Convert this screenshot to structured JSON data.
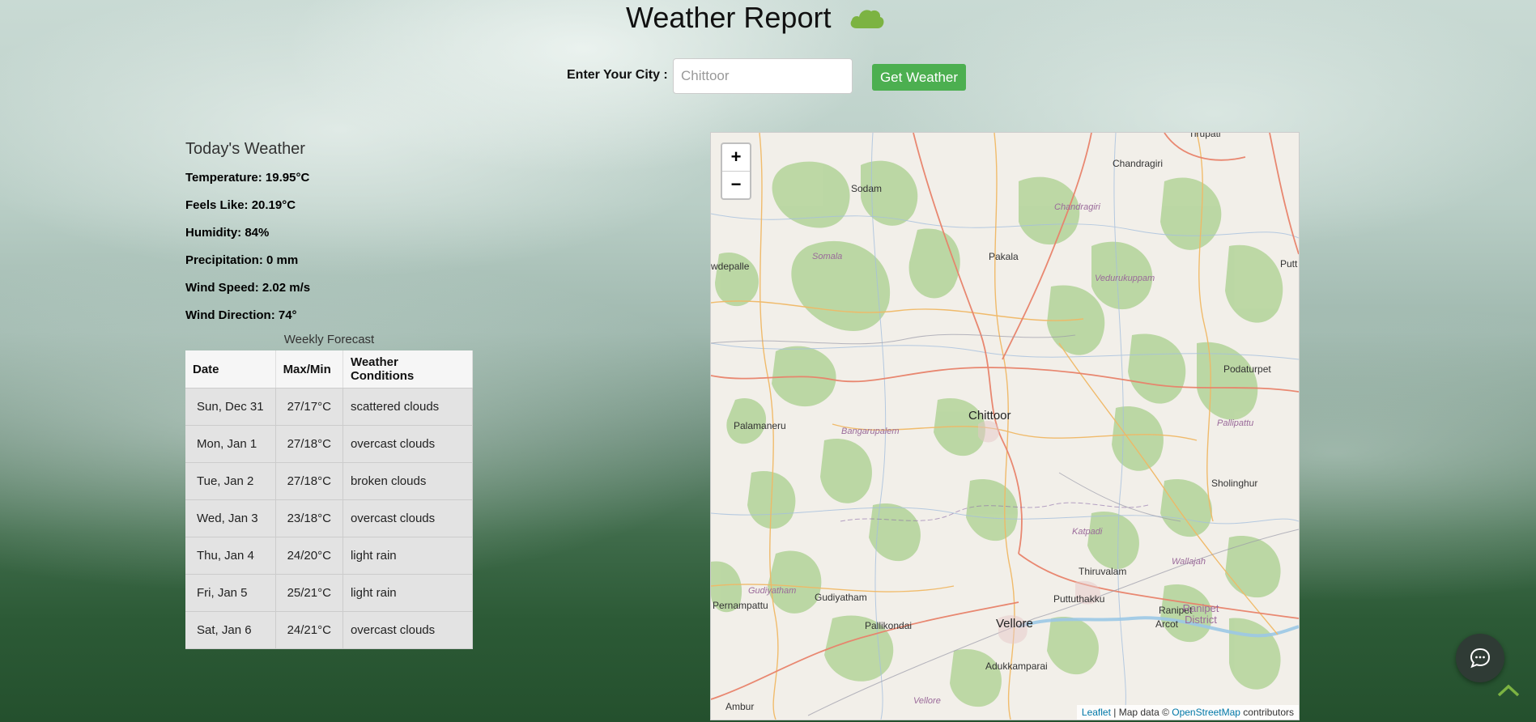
{
  "header": {
    "title": "Weather Report",
    "icon": "cloud-icon"
  },
  "search": {
    "label": "Enter Your City :",
    "placeholder": "Chittoor",
    "button_label": "Get Weather"
  },
  "today": {
    "title": "Today's Weather",
    "stats": [
      "Temperature: 19.95°C",
      "Feels Like: 20.19°C",
      "Humidity: 84%",
      "Precipitation: 0 mm",
      "Wind Speed: 2.02 m/s",
      "Wind Direction: 74°"
    ]
  },
  "forecast": {
    "caption": "Weekly Forecast",
    "headers": [
      "Date",
      "Max/Min",
      "Weather Conditions"
    ],
    "rows": [
      [
        "Sun, Dec 31",
        "27/17°C",
        "scattered clouds"
      ],
      [
        "Mon, Jan 1",
        "27/18°C",
        "overcast clouds"
      ],
      [
        "Tue, Jan 2",
        "27/18°C",
        "broken clouds"
      ],
      [
        "Wed, Jan 3",
        "23/18°C",
        "overcast clouds"
      ],
      [
        "Thu, Jan 4",
        "24/20°C",
        "light rain"
      ],
      [
        "Fri, Jan 5",
        "25/21°C",
        "light rain"
      ],
      [
        "Sat, Jan 6",
        "24/21°C",
        "overcast clouds"
      ]
    ]
  },
  "map": {
    "zoom_in": "+",
    "zoom_out": "−",
    "attribution": {
      "leaflet": "Leaflet",
      "middle": " | Map data © ",
      "osm": "OpenStreetMap",
      "end": " contributors"
    },
    "places": {
      "tirupati": "Tirupati",
      "chandragiri": "Chandragiri",
      "chandragiri_river": "Chandragiri",
      "sodam": "Sodam",
      "wdepalle": "wdepalle",
      "somala": "Somala",
      "pakala": "Pakala",
      "vedurukuppam": "Vedurukuppam",
      "putt": "Putt",
      "podaturpet": "Podaturpet",
      "palamaneru": "Palamaneru",
      "bangarupalem": "Bangarupalem",
      "chittoor": "Chittoor",
      "pallipattu": "Pallipattu",
      "sholinghur": "Sholinghur",
      "katpadi": "Katpadi",
      "wallajah": "Wallajah",
      "thiruvalam": "Thiruvalam",
      "gudiyatham_it": "Gudiyatham",
      "gudiyatham": "Gudiyatham",
      "pernampattu": "Pernampattu",
      "puttuthakku": "Puttuthakku",
      "ranipet": "Ranipet",
      "ranipet_district": "Ranipet District",
      "arcot": "Arcot",
      "pallikondai": "Pallikondai",
      "vellore": "Vellore",
      "adukkamparai": "Adukkamparai",
      "ambur": "Ambur",
      "vellore_it": "Vellore"
    }
  },
  "colors": {
    "accent": "#4caf50",
    "cloud": "#7cb342"
  }
}
